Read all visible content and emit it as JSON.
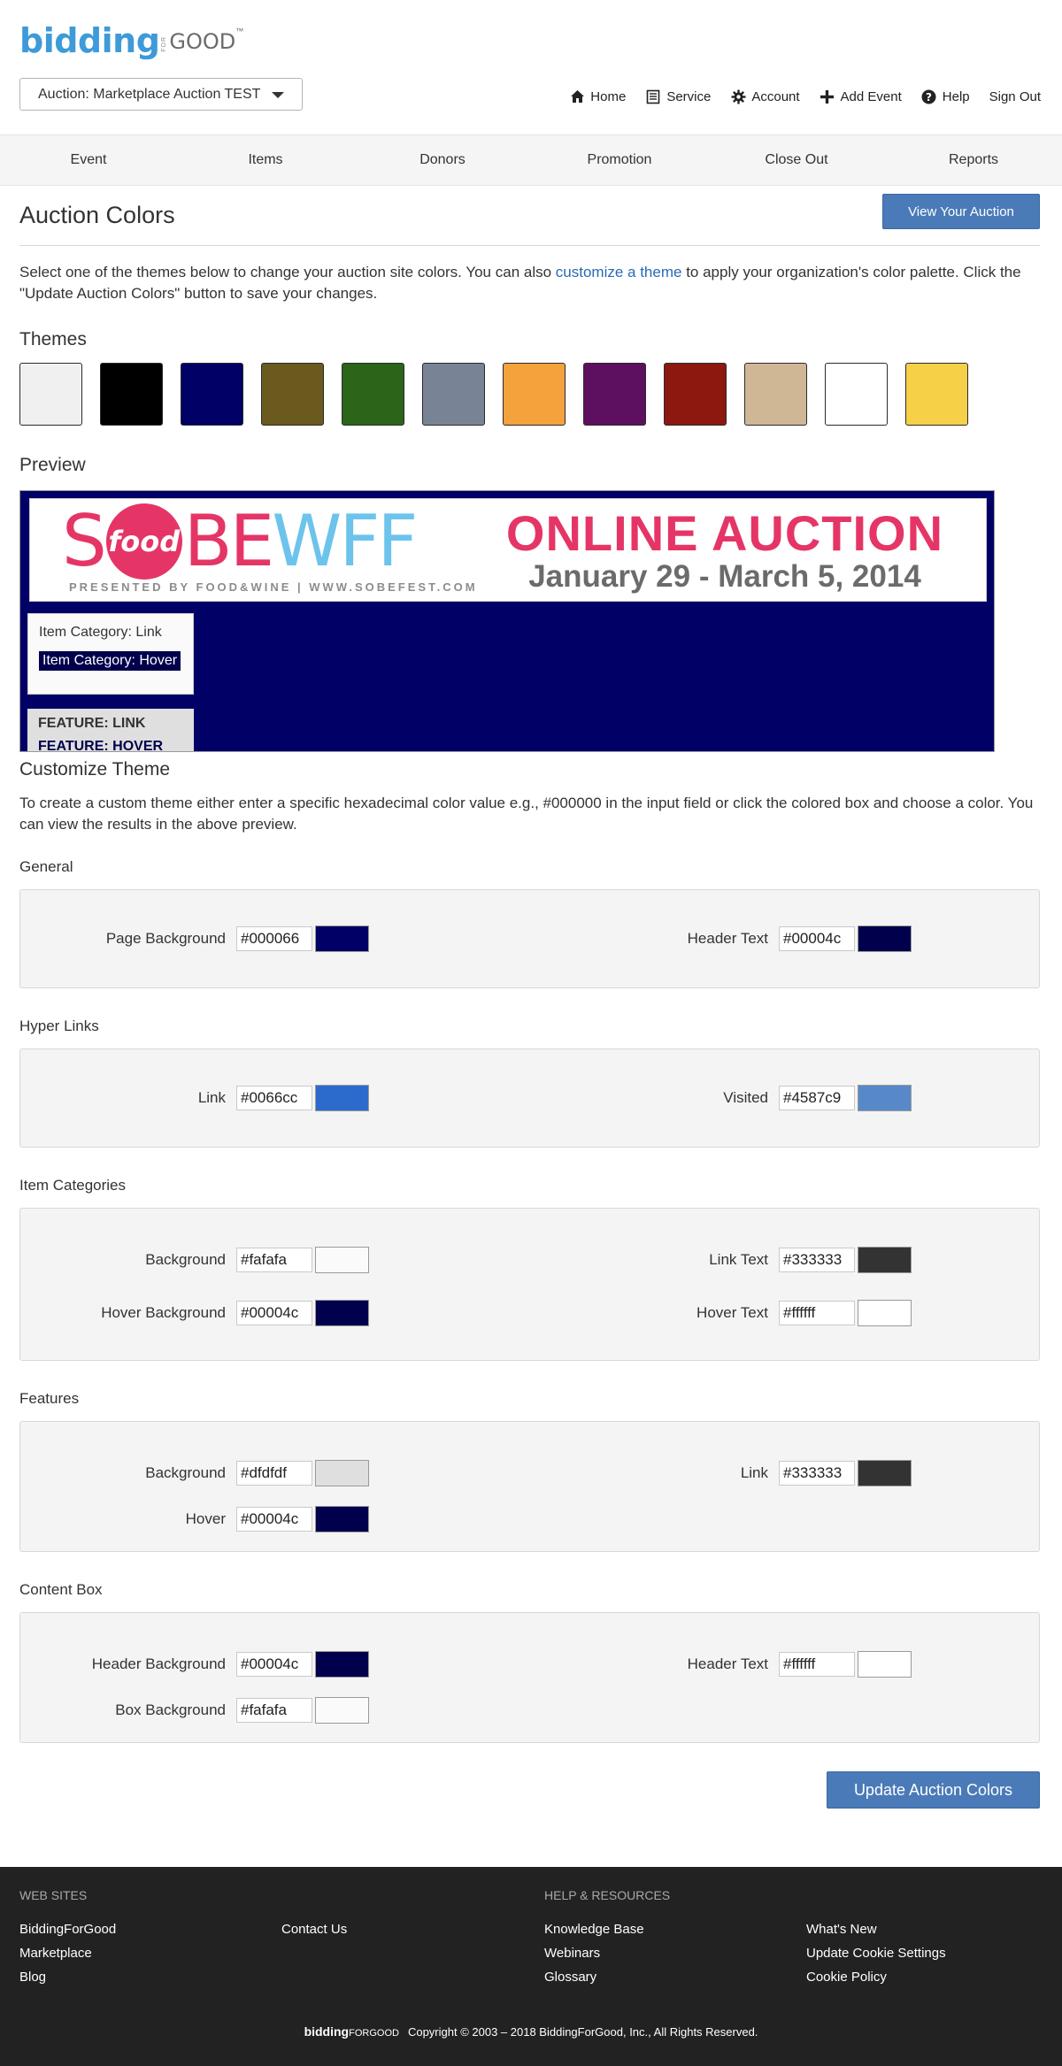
{
  "header": {
    "logo": {
      "main": "bidding",
      "for": "FOR",
      "good": "GOOD",
      "tm": "™"
    },
    "auction_select": "Auction: Marketplace Auction TEST",
    "nav": [
      {
        "label": "Home",
        "icon": "home-icon"
      },
      {
        "label": "Service",
        "icon": "service-icon"
      },
      {
        "label": "Account",
        "icon": "gear-icon"
      },
      {
        "label": "Add Event",
        "icon": "plus-icon"
      },
      {
        "label": "Help",
        "icon": "help-icon"
      },
      {
        "label": "Sign Out",
        "icon": ""
      }
    ]
  },
  "subnav": [
    "Event",
    "Items",
    "Donors",
    "Promotion",
    "Close Out",
    "Reports"
  ],
  "page": {
    "title": "Auction Colors",
    "view_button": "View Your Auction",
    "intro_before": "Select one of the themes below to change your auction site colors. You can also ",
    "intro_link": "customize a theme",
    "intro_after": " to apply your organization's color palette. Click the \"Update Auction Colors\" button to save your changes."
  },
  "themes": {
    "heading": "Themes",
    "colors": [
      "#f0f0f0",
      "#000000",
      "#000066",
      "#6b5a1e",
      "#2b651a",
      "#788496",
      "#f4a23c",
      "#5e1060",
      "#8c1810",
      "#cfb795",
      "#ffffff",
      "#f6d046"
    ]
  },
  "preview": {
    "heading": "Preview",
    "banner": {
      "s": "S",
      "food": "food",
      "be": "BE",
      "wff": "WFF",
      "presented": "PRESENTED BY FOOD&WINE | WWW.SOBEFEST.COM",
      "online": "ONLINE AUCTION",
      "dates": "January 29 - March 5, 2014"
    },
    "category_link": "Item Category: Link",
    "category_hover": "Item Category: Hover",
    "feature_link": "FEATURE: LINK",
    "feature_hover": "FEATURE: HOVER"
  },
  "customize": {
    "heading": "Customize Theme",
    "description": "To create a custom theme either enter a specific hexadecimal color value e.g., #000000 in the input field or click the colored box and choose a color. You can view the results in the above preview.",
    "groups": {
      "general": {
        "title": "General",
        "page_background": {
          "label": "Page Background",
          "value": "#000066",
          "color": "#000066"
        },
        "header_text": {
          "label": "Header Text",
          "value": "#00004c",
          "color": "#00004c"
        }
      },
      "hyperlinks": {
        "title": "Hyper Links",
        "link": {
          "label": "Link",
          "value": "#0066cc",
          "color": "#2c6bcc"
        },
        "visited": {
          "label": "Visited",
          "value": "#4587c9",
          "color": "#5789c9"
        }
      },
      "item_categories": {
        "title": "Item Categories",
        "background": {
          "label": "Background",
          "value": "#fafafa",
          "color": "#fafafa"
        },
        "link_text": {
          "label": "Link Text",
          "value": "#333333",
          "color": "#333333"
        },
        "hover_background": {
          "label": "Hover Background",
          "value": "#00004c",
          "color": "#00004c"
        },
        "hover_text": {
          "label": "Hover Text",
          "value": "#ffffff",
          "color": "#ffffff"
        }
      },
      "features": {
        "title": "Features",
        "background": {
          "label": "Background",
          "value": "#dfdfdf",
          "color": "#dfdfdf"
        },
        "link": {
          "label": "Link",
          "value": "#333333",
          "color": "#333333"
        },
        "hover": {
          "label": "Hover",
          "value": "#00004c",
          "color": "#00004c"
        }
      },
      "content_box": {
        "title": "Content Box",
        "header_background": {
          "label": "Header Background",
          "value": "#00004c",
          "color": "#00004c"
        },
        "header_text": {
          "label": "Header Text",
          "value": "#ffffff",
          "color": "#ffffff"
        },
        "box_background": {
          "label": "Box Background",
          "value": "#fafafa",
          "color": "#fafafa"
        }
      }
    },
    "update_button": "Update Auction Colors"
  },
  "footer": {
    "web_sites": {
      "heading": "WEB SITES",
      "col1": [
        "BiddingForGood",
        "Marketplace",
        "Blog"
      ],
      "col2": [
        "Contact Us"
      ]
    },
    "help": {
      "heading": "HELP & RESOURCES",
      "col1": [
        "Knowledge Base",
        "Webinars",
        "Glossary"
      ],
      "col2": [
        "What's New",
        "Update Cookie Settings",
        "Cookie Policy"
      ]
    },
    "logo_main": "bidding",
    "logo_good": "FORGOOD",
    "copyright": "Copyright © 2003 – 2018 BiddingForGood, Inc., All Rights Reserved."
  }
}
